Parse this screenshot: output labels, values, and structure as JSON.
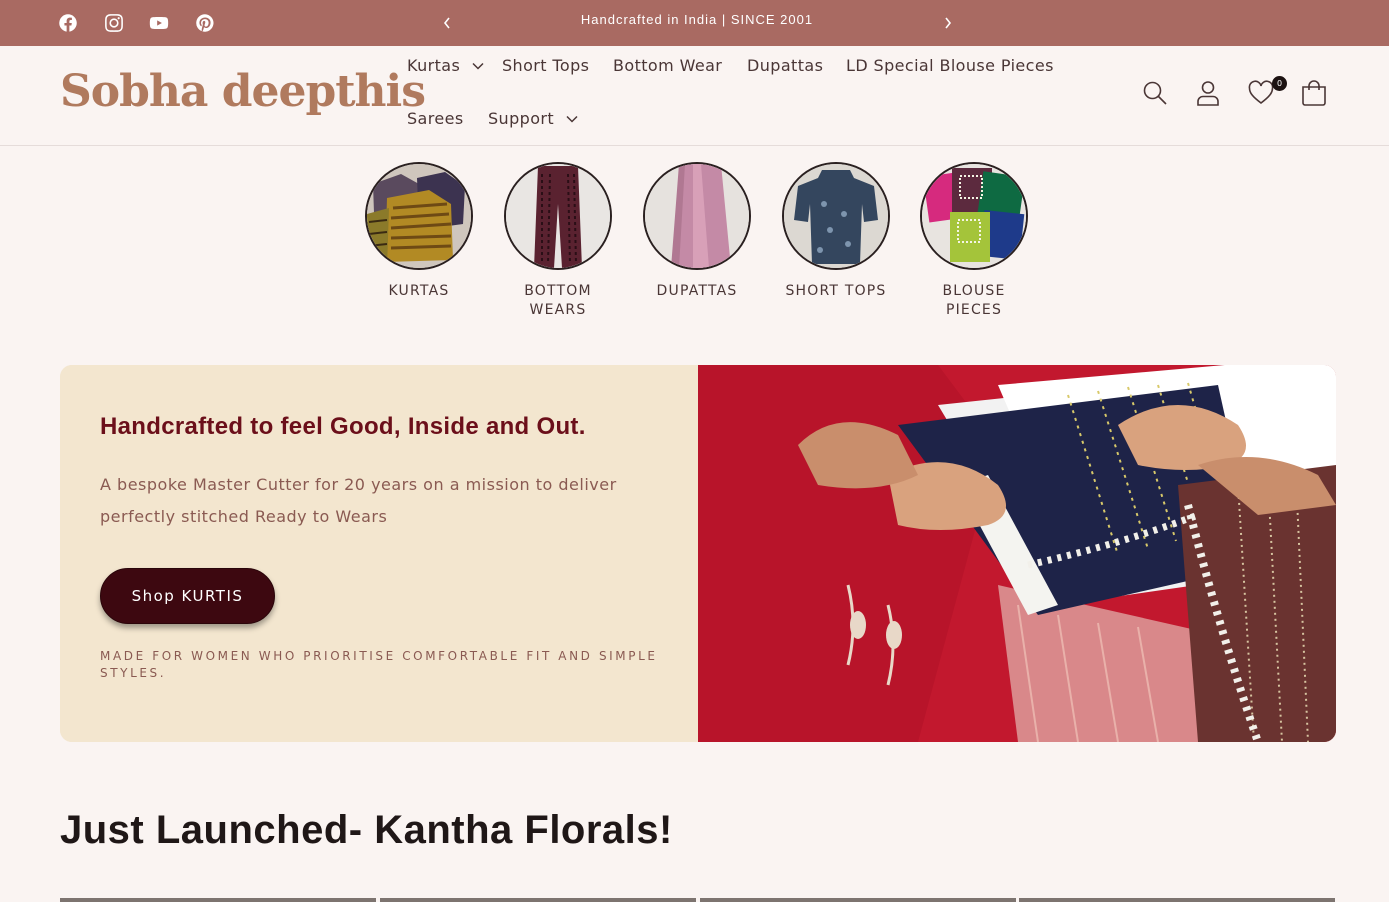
{
  "announcement": {
    "text": "Handcrafted in India | SINCE 2001",
    "social_icons": [
      "facebook-icon",
      "instagram-icon",
      "youtube-icon",
      "pinterest-icon"
    ]
  },
  "header": {
    "logo_text": "Sobha deepthis",
    "nav": [
      {
        "label": "Kurtas",
        "has_dropdown": true
      },
      {
        "label": "Short Tops",
        "has_dropdown": false
      },
      {
        "label": "Bottom Wear",
        "has_dropdown": false
      },
      {
        "label": "Dupattas",
        "has_dropdown": false
      },
      {
        "label": "LD Special Blouse Pieces",
        "has_dropdown": false
      },
      {
        "label": "Sarees",
        "has_dropdown": false
      },
      {
        "label": "Support",
        "has_dropdown": true
      }
    ],
    "icons": [
      "search-icon",
      "account-icon",
      "wishlist-icon",
      "cart-icon"
    ],
    "wishlist_count": "0"
  },
  "categories": [
    {
      "label": "KURTAS"
    },
    {
      "label": "BOTTOM WEARS"
    },
    {
      "label": "DUPATTAS"
    },
    {
      "label": "SHORT TOPS"
    },
    {
      "label": "BLOUSE PIECES"
    }
  ],
  "hero": {
    "title": "Handcrafted to feel Good, Inside and Out.",
    "description": "A bespoke Master Cutter for 20 years on a mission to deliver perfectly stitched Ready to Wears",
    "button_label": "Shop KURTIS",
    "tagline": "MADE FOR WOMEN WHO PRIORITISE COMFORTABLE FIT AND SIMPLE STYLES."
  },
  "section": {
    "title": "Just Launched- Kantha Florals!"
  },
  "colors": {
    "announcement_bg": "#a96a62",
    "page_bg": "#faf4f2",
    "hero_panel_bg": "#f3e6cf",
    "accent_maroon": "#6b0f1a",
    "button_bg": "#3d0810",
    "logo": "#b07a5e"
  }
}
